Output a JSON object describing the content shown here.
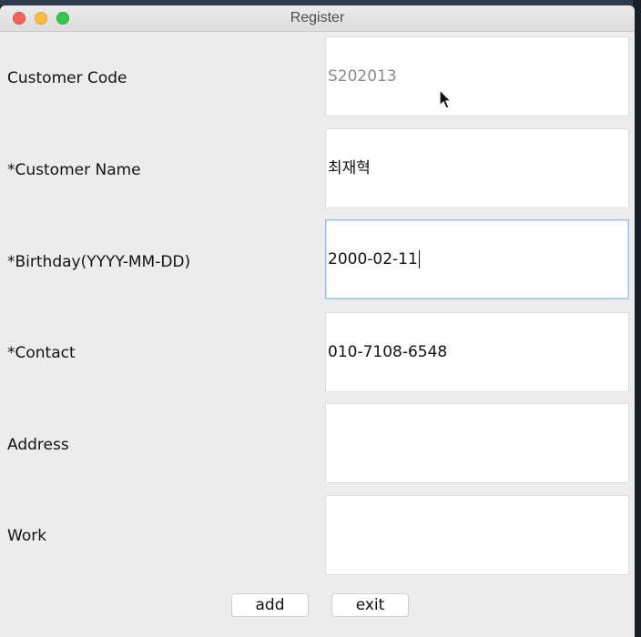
{
  "window": {
    "title": "Register"
  },
  "form": {
    "customer_code": {
      "label": "Customer Code",
      "value": "S202013"
    },
    "customer_name": {
      "label": "*Customer Name",
      "value": "최재혁"
    },
    "birthday": {
      "label": "*Birthday(YYYY-MM-DD)",
      "value": "2000-02-11"
    },
    "contact": {
      "label": "*Contact",
      "value": "010-7108-6548"
    },
    "address": {
      "label": "Address",
      "value": ""
    },
    "work": {
      "label": "Work",
      "value": ""
    }
  },
  "buttons": {
    "add": "add",
    "exit": "exit"
  },
  "icons": {
    "pointer": "mouse-pointer-icon"
  }
}
